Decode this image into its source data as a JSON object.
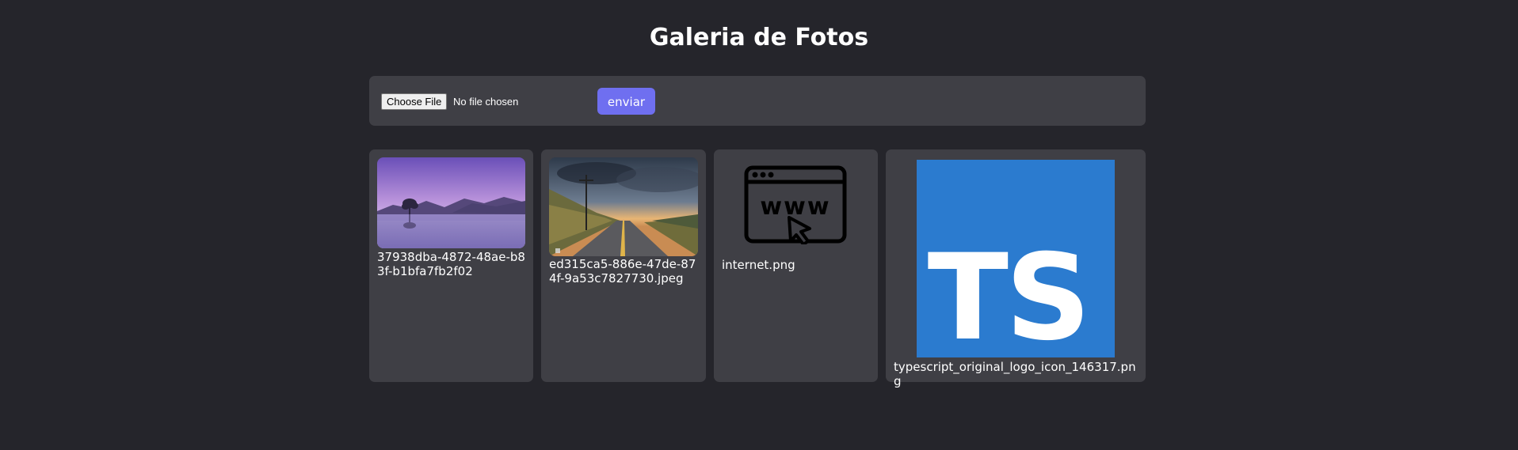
{
  "title": "Galeria de Fotos",
  "upload": {
    "choose_label": "Choose File",
    "status": "No file chosen",
    "send_label": "enviar"
  },
  "gallery": [
    {
      "filename": "37938dba-4872-48ae-b83f-b1bfa7fb2f02",
      "image": "lake-with-tree-photo"
    },
    {
      "filename": "ed315ca5-886e-47de-874f-9a53c7827730.jpeg",
      "image": "road-sunset-photo"
    },
    {
      "filename": "internet.png",
      "image": "www-browser-icon"
    },
    {
      "filename": "typescript_original_logo_icon_146317.png",
      "image": "typescript-logo"
    }
  ],
  "colors": {
    "background": "#25252b",
    "panel": "#3f3f45",
    "accent": "#6f6ff0",
    "typescript_blue": "#2b7bcf"
  }
}
